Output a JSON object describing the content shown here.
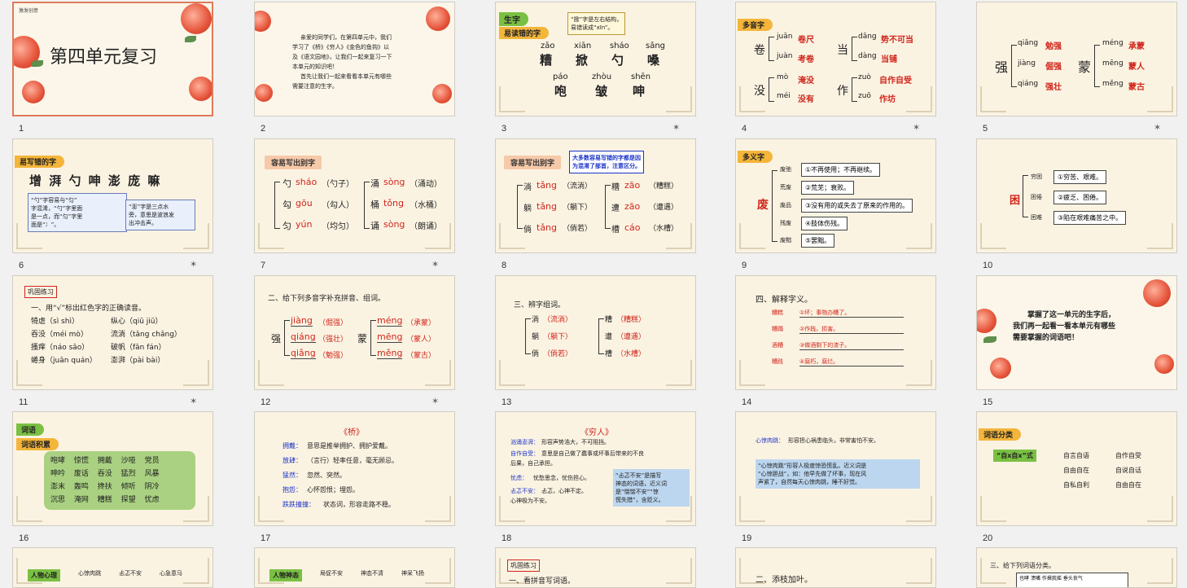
{
  "slides": [
    {
      "n": "1",
      "title": "第四单元复习",
      "logo": "激发创意"
    },
    {
      "n": "2",
      "intro": [
        "亲爱的同学们，在第四单元中，我们",
        "学习了《桥》《穷人》《金色的鱼钩》以",
        "及《语文园地》，让我们一起来复习一下",
        "本单元的知识吧！",
        "首先让我们一起来看看本单元有哪些",
        "需要注意的生字。"
      ]
    },
    {
      "n": "3",
      "tag1": "生字",
      "tag2": "易读错的字",
      "note": [
        "“掀”字是左右结构，",
        "易错读成“xīn”。"
      ],
      "row1": [
        {
          "py": "zāo",
          "ch": "糟"
        },
        {
          "py": "xiān",
          "ch": "掀"
        },
        {
          "py": "sháo",
          "ch": "勺"
        },
        {
          "py": "sǎng",
          "ch": "嗓"
        }
      ],
      "row2": [
        {
          "py": "páo",
          "ch": "咆"
        },
        {
          "py": "zhòu",
          "ch": "皱"
        },
        {
          "py": "shēn",
          "ch": "呻"
        }
      ]
    },
    {
      "n": "4",
      "tag": "多音字",
      "groups": [
        {
          "ch": "卷",
          "items": [
            {
              "py": "juān",
              "w": "卷尺"
            },
            {
              "py": "juàn",
              "w": "考卷"
            }
          ]
        },
        {
          "ch": "当",
          "items": [
            {
              "py": "dāng",
              "w": "势不可当"
            },
            {
              "py": "dàng",
              "w": "当铺"
            }
          ]
        },
        {
          "ch": "没",
          "items": [
            {
              "py": "mò",
              "w": "淹没"
            },
            {
              "py": "méi",
              "w": "没有"
            }
          ]
        },
        {
          "ch": "作",
          "items": [
            {
              "py": "zuò",
              "w": "自作自受"
            },
            {
              "py": "zuō",
              "w": "作坊"
            }
          ]
        }
      ]
    },
    {
      "n": "5",
      "groups": [
        {
          "ch": "强",
          "items": [
            {
              "py": "qiǎng",
              "w": "勉强"
            },
            {
              "py": "jiàng",
              "w": "倔强"
            },
            {
              "py": "qiáng",
              "w": "强壮"
            }
          ]
        },
        {
          "ch": "蒙",
          "items": [
            {
              "py": "méng",
              "w": "承蒙"
            },
            {
              "py": "mēng",
              "w": "蒙人"
            },
            {
              "py": "měng",
              "w": "蒙古"
            }
          ]
        }
      ]
    },
    {
      "n": "6",
      "tag": "易写错的字",
      "chars": "增 湃 勺 呻 澎 庞 嘛",
      "c1": [
        "“勺”字容易与“匀”",
        "字混淆，“勺”字里面",
        "是一点，而“匀”字里",
        "面是“冫”。"
      ],
      "c2": [
        "“澎”字是三点水",
        "旁，意思是波浪发",
        "出冲击声。"
      ]
    },
    {
      "n": "7",
      "tag": "容易写出别字",
      "left": [
        {
          "ch": "勺",
          "py": "sháo",
          "w": "（勺子）"
        },
        {
          "ch": "勾",
          "py": "gōu",
          "w": "（勾人）"
        },
        {
          "ch": "匀",
          "py": "yún",
          "w": "（均匀）"
        }
      ],
      "right": [
        {
          "ch": "涌",
          "py": "sòng",
          "w": "（涌动）"
        },
        {
          "ch": "桶",
          "py": "tǒng",
          "w": "（水桶）"
        },
        {
          "ch": "诵",
          "py": "sòng",
          "w": "（朗诵）"
        }
      ]
    },
    {
      "n": "8",
      "tag": "容易写出别字",
      "note": [
        "大多数容易写错的字都是因",
        "为混淆了部首，注意区分。"
      ],
      "left": [
        {
          "ch": "淌",
          "py": "tǎng",
          "w": "（流淌）"
        },
        {
          "ch": "躺",
          "py": "tǎng",
          "w": "（躺下）"
        },
        {
          "ch": "倘",
          "py": "tǎng",
          "w": "（倘若）"
        }
      ],
      "right": [
        {
          "ch": "糟",
          "py": "zāo",
          "w": "（糟糕）"
        },
        {
          "ch": "遭",
          "py": "zāo",
          "w": "（遭遇）"
        },
        {
          "ch": "槽",
          "py": "cáo",
          "w": "（水槽）"
        }
      ]
    },
    {
      "n": "9",
      "tag": "多义字",
      "root": "废",
      "items": [
        {
          "w": "废弛",
          "d": "①不再使用；不再继续。"
        },
        {
          "w": "荒废",
          "d": "②荒芜；衰败。"
        },
        {
          "w": "废品",
          "d": "③没有用的或失去了原来的作用的。"
        },
        {
          "w": "残废",
          "d": "④肢体伤残。"
        },
        {
          "w": "废黜",
          "d": "⑤罢黜。"
        }
      ]
    },
    {
      "n": "10",
      "root": "困",
      "items": [
        {
          "w": "穷困",
          "d": "①穷苦、艰难。"
        },
        {
          "w": "困倦",
          "d": "②疲乏、困倦。"
        },
        {
          "w": "困难",
          "d": "③陷在艰难痛苦之中。"
        }
      ]
    },
    {
      "n": "11",
      "tag": "巩固练习",
      "q": "一、用“√”标出红色字的正确读音。",
      "rows": [
        [
          "犄虐（sì shì）",
          "纵心（qiū jiū）"
        ],
        [
          "吞没（méi mò）",
          "流淌（tǎng chǎng）"
        ],
        [
          "搔痒（náo sāo）",
          "破帆（fān fán）"
        ],
        [
          "蜷身（juān quán）",
          "澎湃（pài bài）"
        ]
      ]
    },
    {
      "n": "12",
      "q": "二、给下列多音字补充拼音、组词。",
      "left": {
        "ch": "强",
        "items": [
          {
            "py": "jiàng",
            "w": "（倔强）"
          },
          {
            "py": "qiáng",
            "w": "（强壮）"
          },
          {
            "py": "qiǎng",
            "w": "（勉强）"
          }
        ]
      },
      "right": {
        "ch": "蒙",
        "items": [
          {
            "py": "méng",
            "w": "（承蒙）"
          },
          {
            "py": "mēng",
            "w": "（蒙人）"
          },
          {
            "py": "měng",
            "w": "（蒙古）"
          }
        ]
      }
    },
    {
      "n": "13",
      "q": "三、辨字组词。",
      "left": [
        {
          "ch": "淌",
          "w": "（流淌）"
        },
        {
          "ch": "躺",
          "w": "（躺下）"
        },
        {
          "ch": "倘",
          "w": "（倘若）"
        }
      ],
      "right": [
        {
          "ch": "糟",
          "w": "（糟糕）"
        },
        {
          "ch": "遭",
          "w": "（遭遇）"
        },
        {
          "ch": "槽",
          "w": "（水槽）"
        }
      ]
    },
    {
      "n": "14",
      "q": "四、解释字义。",
      "items": [
        {
          "w": "糟糕",
          "d": "①坏；事物办糟了。"
        },
        {
          "w": "糟蹋",
          "d": "②作践。损害。"
        },
        {
          "w": "酒糟",
          "d": "③做酒剩下的渣子。"
        },
        {
          "w": "糟践",
          "d": "④腐朽，腐烂。"
        }
      ]
    },
    {
      "n": "15",
      "lines": [
        "掌握了这一单元的生字后，",
        "我们再一起看一看本单元有哪些",
        "需要掌握的词语吧！"
      ]
    },
    {
      "n": "16",
      "tag1": "词语",
      "tag2": "词语积累",
      "rows": [
        [
          "咆哮",
          "惊慌",
          "拥戴",
          "沙哑",
          "党员"
        ],
        [
          "呻吟",
          "废话",
          "吞没",
          "猛烈",
          "风暴"
        ],
        [
          "澎末",
          "轰鸣",
          "搀扶",
          "倾听",
          "阴冷"
        ],
        [
          "沉思",
          "淹网",
          "糟糕",
          "探望",
          "忧虑"
        ]
      ]
    },
    {
      "n": "17",
      "title": "《桥》",
      "items": [
        {
          "w": "拥戴：",
          "d": "意思是推举拥护、拥护爱戴。"
        },
        {
          "w": "放肆：",
          "d": "（言行）轻率任意，毫无顾忌。"
        },
        {
          "w": "猛然：",
          "d": "忽然、突然。"
        },
        {
          "w": "抱怨：",
          "d": "心怀怨恨；埋怨。"
        },
        {
          "w": "跌跌撞撞：",
          "d": "状态词，形容走路不稳。"
        }
      ]
    },
    {
      "n": "18",
      "title": "《穷人》",
      "items": [
        {
          "w": "汹涌澎湃：",
          "d": "形容声势浩大，不可阻挡。"
        },
        {
          "w": "自作自受：",
          "d": "意思是自己做了蠢事或坏事后带来的不良"
        },
        {
          "w": "",
          "d": "后果，自己承担。"
        },
        {
          "w": "忧虑：",
          "d": "忧愁思念，忧伤担心。"
        },
        {
          "w": "忐忑不安：",
          "d": "忐忑，心神不定。"
        },
        {
          "w": "",
          "d": "心神极为不安。"
        }
      ],
      "hl": [
        "“忐忑不安”是描写",
        "神态的词语，近义词",
        "是“惴惴不安”“惊",
        "慌失措”，含贬义。"
      ]
    },
    {
      "n": "19",
      "items": [
        {
          "w": "心惊肉跳：",
          "d": "形容担心祸患临头，非常害怕不安。"
        }
      ],
      "hl": [
        "“心惊肉跳”形容人极度惊恐慌乱。近义词是",
        "“心惊胆战”，如：他早先做了坏事，现在风",
        "声紧了，自然每天心惊肉跳，睡不好觉。"
      ]
    },
    {
      "n": "20",
      "tag": "词语分类",
      "label": "“自x自x”式",
      "words": [
        [
          "自言自语",
          "自作自受"
        ],
        [
          "自由自在",
          "自说自话"
        ],
        [
          "自私自利",
          "自由自在"
        ]
      ]
    },
    {
      "n": "21",
      "tag": "人物心理",
      "words": [
        "心惊肉跳",
        "忐忑不安",
        "心急意马"
      ]
    },
    {
      "n": "22",
      "tag": "人物神态",
      "words": [
        "局促不安",
        "神态不清",
        "神采飞扬"
      ]
    },
    {
      "n": "23",
      "tag": "巩固练习",
      "q": "一、看拼音写词语。"
    },
    {
      "n": "24",
      "q": "二、添枝加叶。"
    },
    {
      "n": "25",
      "q": "三、给下列词语分类。",
      "words": [
        "也哮",
        "溃嘴",
        "作揖我摇",
        "垂头丧气"
      ]
    }
  ]
}
